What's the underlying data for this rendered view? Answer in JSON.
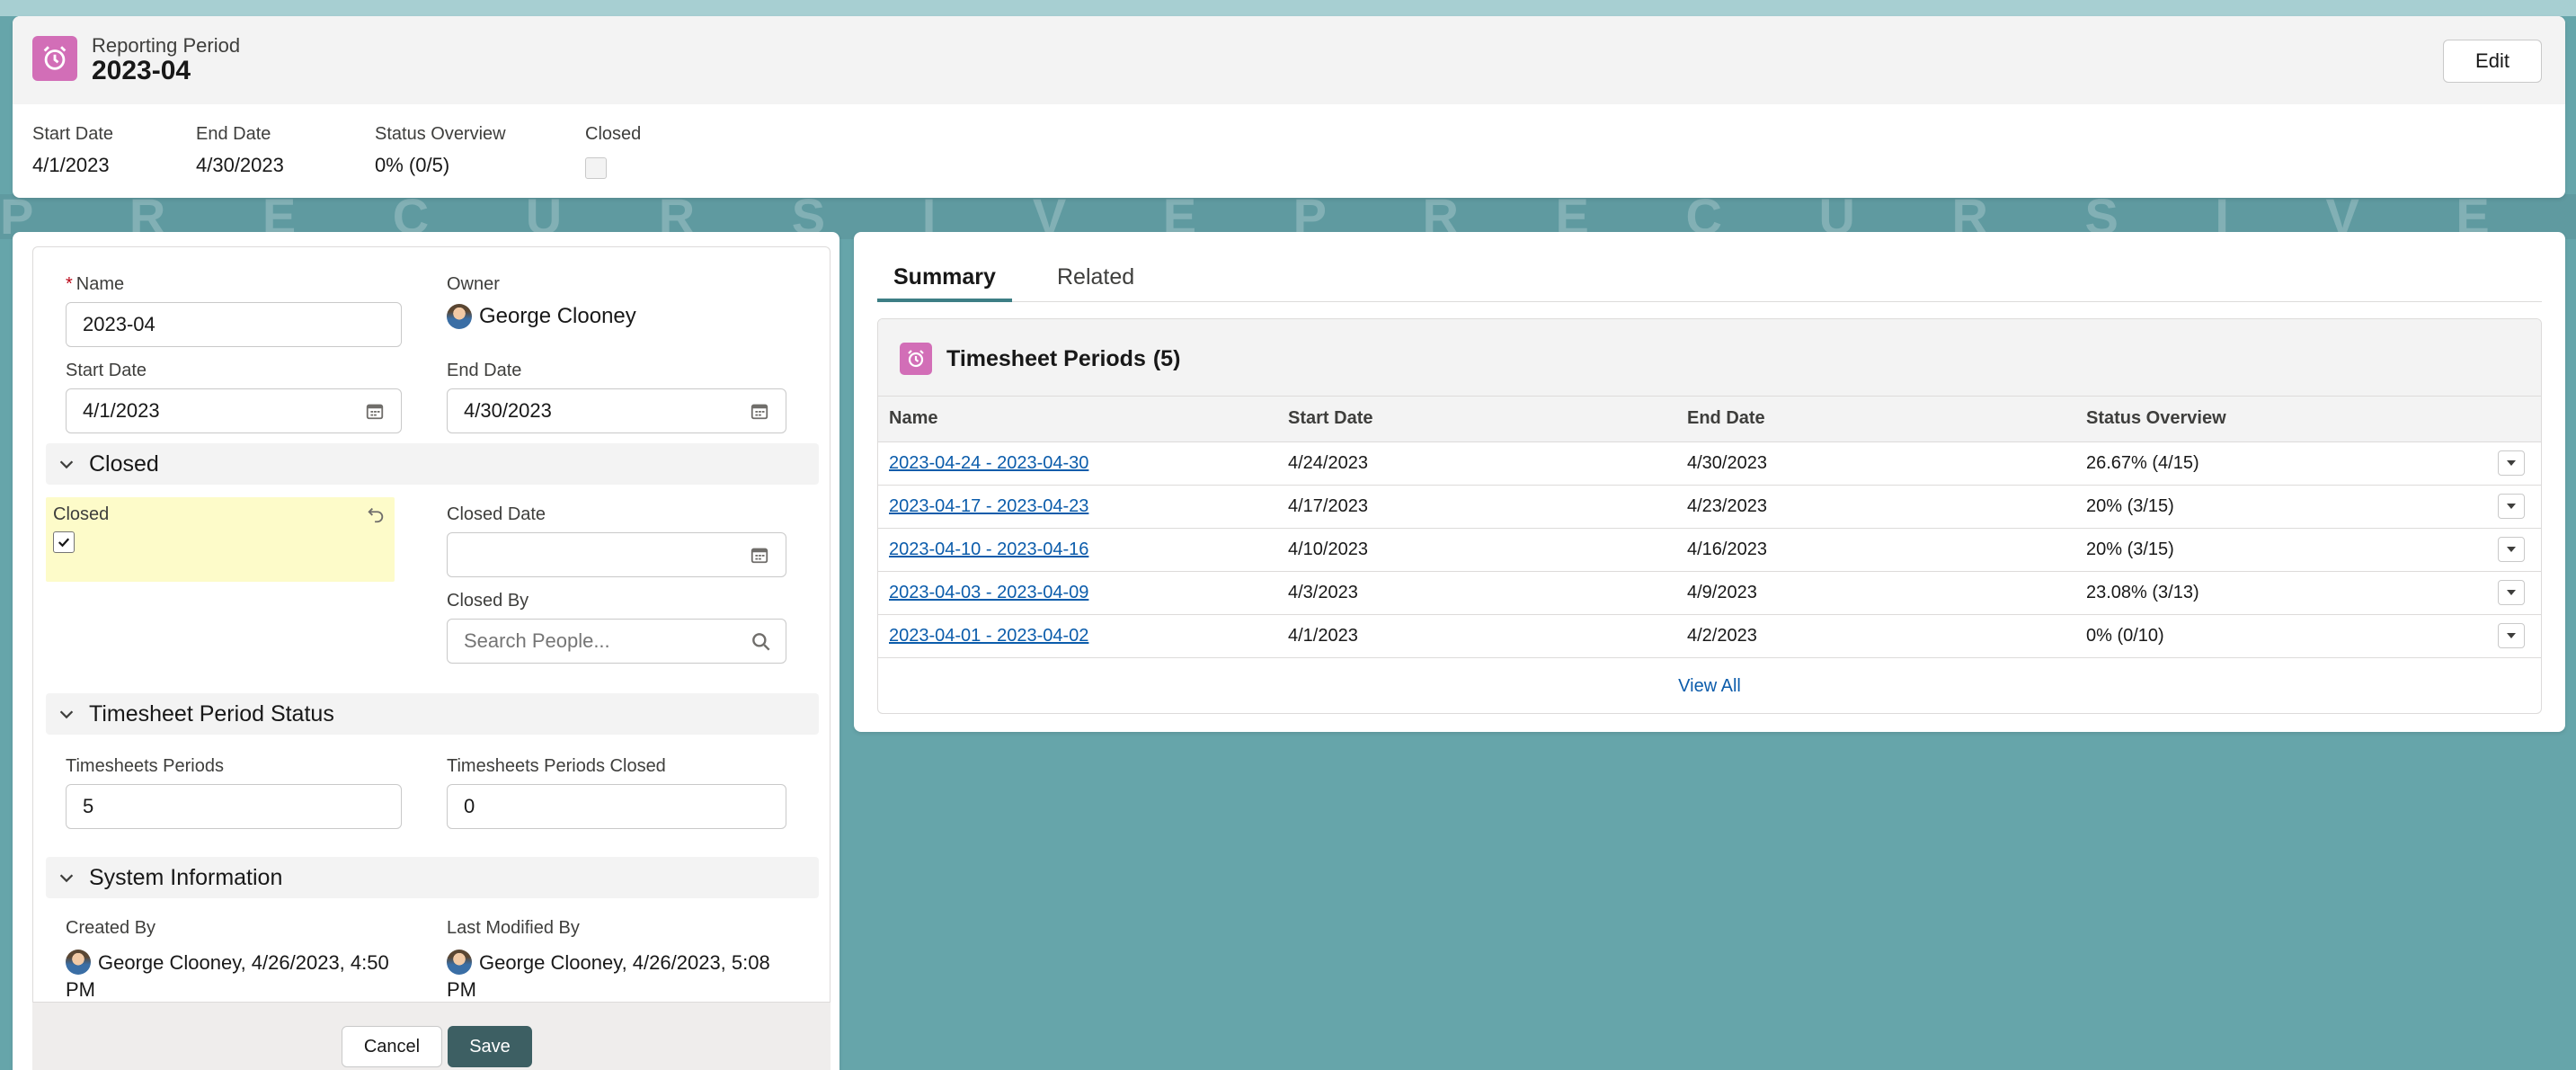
{
  "header": {
    "object_type": "Reporting Period",
    "title": "2023-04",
    "edit_label": "Edit",
    "highlights": [
      {
        "label": "Start Date",
        "value": "4/1/2023"
      },
      {
        "label": "End Date",
        "value": "4/30/2023"
      },
      {
        "label": "Status Overview",
        "value": "0% (0/5)"
      },
      {
        "label": "Closed",
        "value": ""
      }
    ],
    "brand_color": "#d26eb7"
  },
  "watermark": "P R E C U R S I V E P R E C U R S I V E P R E C U",
  "form": {
    "name_label": "Name",
    "name_value": "2023-04",
    "owner_label": "Owner",
    "owner_value": "George Clooney",
    "start_label": "Start Date",
    "start_value": "4/1/2023",
    "end_label": "End Date",
    "end_value": "4/30/2023",
    "closed_section": "Closed",
    "closed_label": "Closed",
    "closed_checked": true,
    "closed_date_label": "Closed Date",
    "closed_date_value": "",
    "closed_by_label": "Closed By",
    "closed_by_placeholder": "Search People...",
    "status_section": "Timesheet Period Status",
    "periods_label": "Timesheets Periods",
    "periods_value": "5",
    "periods_closed_label": "Timesheets Periods Closed",
    "periods_closed_value": "0",
    "system_section": "System Information",
    "created_by_label": "Created By",
    "created_by_value": "George Clooney, 4/26/2023, 4:50 PM",
    "modified_by_label": "Last Modified By",
    "modified_by_value": "George Clooney, 4/26/2023, 5:08 PM",
    "cancel_label": "Cancel",
    "save_label": "Save"
  },
  "tabs": [
    {
      "label": "Summary",
      "active": true
    },
    {
      "label": "Related",
      "active": false
    }
  ],
  "related": {
    "title": "Timesheet Periods",
    "count": "(5)",
    "columns": [
      "Name",
      "Start Date",
      "End Date",
      "Status Overview"
    ],
    "rows": [
      [
        "2023-04-24 - 2023-04-30",
        "4/24/2023",
        "4/30/2023",
        "26.67% (4/15)"
      ],
      [
        "2023-04-17 - 2023-04-23",
        "4/17/2023",
        "4/23/2023",
        "20% (3/15)"
      ],
      [
        "2023-04-10 - 2023-04-16",
        "4/10/2023",
        "4/16/2023",
        "20% (3/15)"
      ],
      [
        "2023-04-03 - 2023-04-09",
        "4/3/2023",
        "4/9/2023",
        "23.08% (3/13)"
      ],
      [
        "2023-04-01 - 2023-04-02",
        "4/1/2023",
        "4/2/2023",
        "0% (0/10)"
      ]
    ],
    "view_all": "View All"
  }
}
